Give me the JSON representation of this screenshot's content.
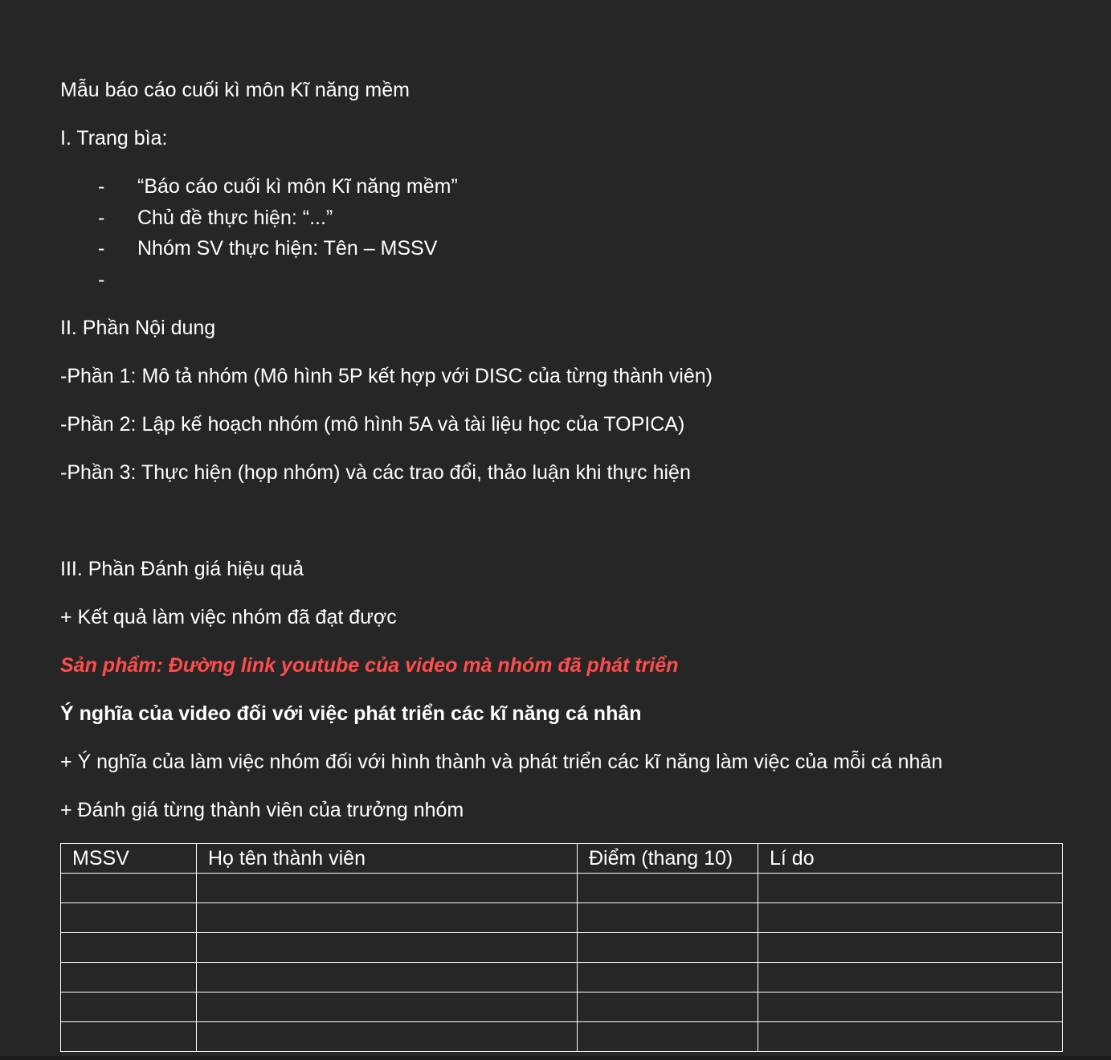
{
  "doc": {
    "title": "Mẫu báo cáo cuối kì môn Kĩ năng mềm",
    "section1": {
      "heading": "I. Trang bìa:",
      "bullets": [
        "“Báo cáo cuối kì môn Kĩ năng mềm”",
        "Chủ đề thực hiện: “...”",
        "Nhóm SV thực hiện: Tên – MSSV",
        ""
      ],
      "bullet_marker": "-"
    },
    "section2": {
      "heading": "II. Phần Nội dung",
      "items": [
        "-Phần 1: Mô tả nhóm  (Mô hình 5P kết hợp với DISC của từng thành viên)",
        "-Phần 2: Lập kế hoạch nhóm (mô hình 5A và tài liệu học của TOPICA)",
        "-Phần 3: Thực hiện (họp nhóm) và các trao đổi, thảo luận khi thực hiện"
      ]
    },
    "section3": {
      "heading": "III. Phần  Đánh giá hiệu quả",
      "result_line": "+ Kết quả làm việc nhóm đã đạt được",
      "product_line": "Sản phẩm: Đường link youtube của video mà nhóm đã phát triển",
      "meaning_video": "Ý nghĩa của video đối với việc phát triển các kĩ năng cá nhân",
      "meaning_team": "+ Ý nghĩa của làm việc nhóm đối với hình thành và phát triển các kĩ năng làm việc của mỗi cá nhân",
      "evaluation_line": "+ Đánh giá từng thành viên của trưởng nhóm"
    },
    "table": {
      "headers": [
        "MSSV",
        "Họ tên thành viên",
        "Điểm (thang 10)",
        "Lí do"
      ],
      "rows": [
        [
          "",
          "",
          "",
          ""
        ],
        [
          "",
          "",
          "",
          ""
        ],
        [
          "",
          "",
          "",
          ""
        ],
        [
          "",
          "",
          "",
          ""
        ],
        [
          "",
          "",
          "",
          ""
        ],
        [
          "",
          "",
          "",
          ""
        ]
      ]
    }
  },
  "colors": {
    "background": "#262626",
    "text": "#ffffff",
    "highlight": "#ff4d4d"
  }
}
